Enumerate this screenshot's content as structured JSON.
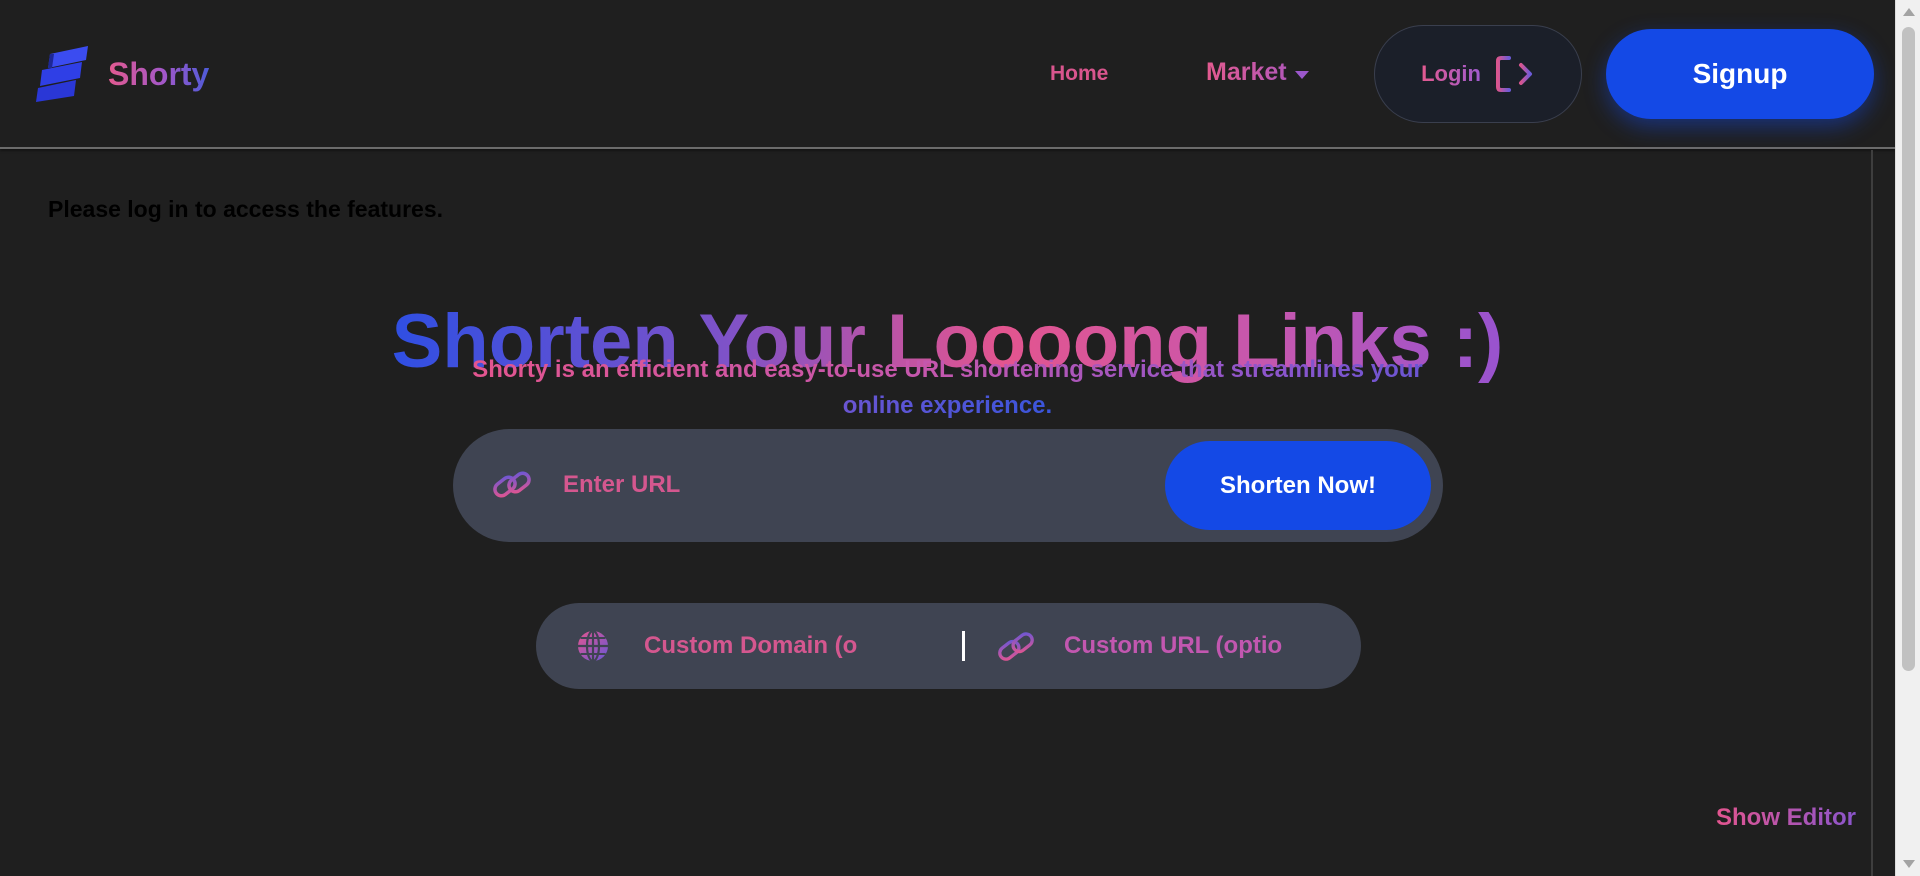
{
  "brand": {
    "name": "Shorty",
    "logo_icon": "stacked-bars-logo-icon"
  },
  "nav": {
    "home_label": "Home",
    "market_label": "Market",
    "login_label": "Login",
    "signup_label": "Signup"
  },
  "notice": "Please log in to access the features.",
  "hero": {
    "title": "Shorten Your Loooong Links :)",
    "subtitle": "Shorty is an efficient and easy-to-use URL shortening service that streamlines your online experience."
  },
  "shortener": {
    "url_placeholder": "Enter URL",
    "url_value": "",
    "submit_label": "Shorten Now!"
  },
  "custom": {
    "domain_placeholder": "Custom Domain (optional)",
    "url_placeholder": "Custom URL (optional)"
  },
  "editor_toggle_label": "Show Editor",
  "colors": {
    "background": "#1f1f1f",
    "primary_button": "#1449e6",
    "input_bar": "#3f4452",
    "accent_pink": "#e3558f",
    "accent_purple": "#9853cf",
    "accent_blue": "#2f4fe3"
  }
}
